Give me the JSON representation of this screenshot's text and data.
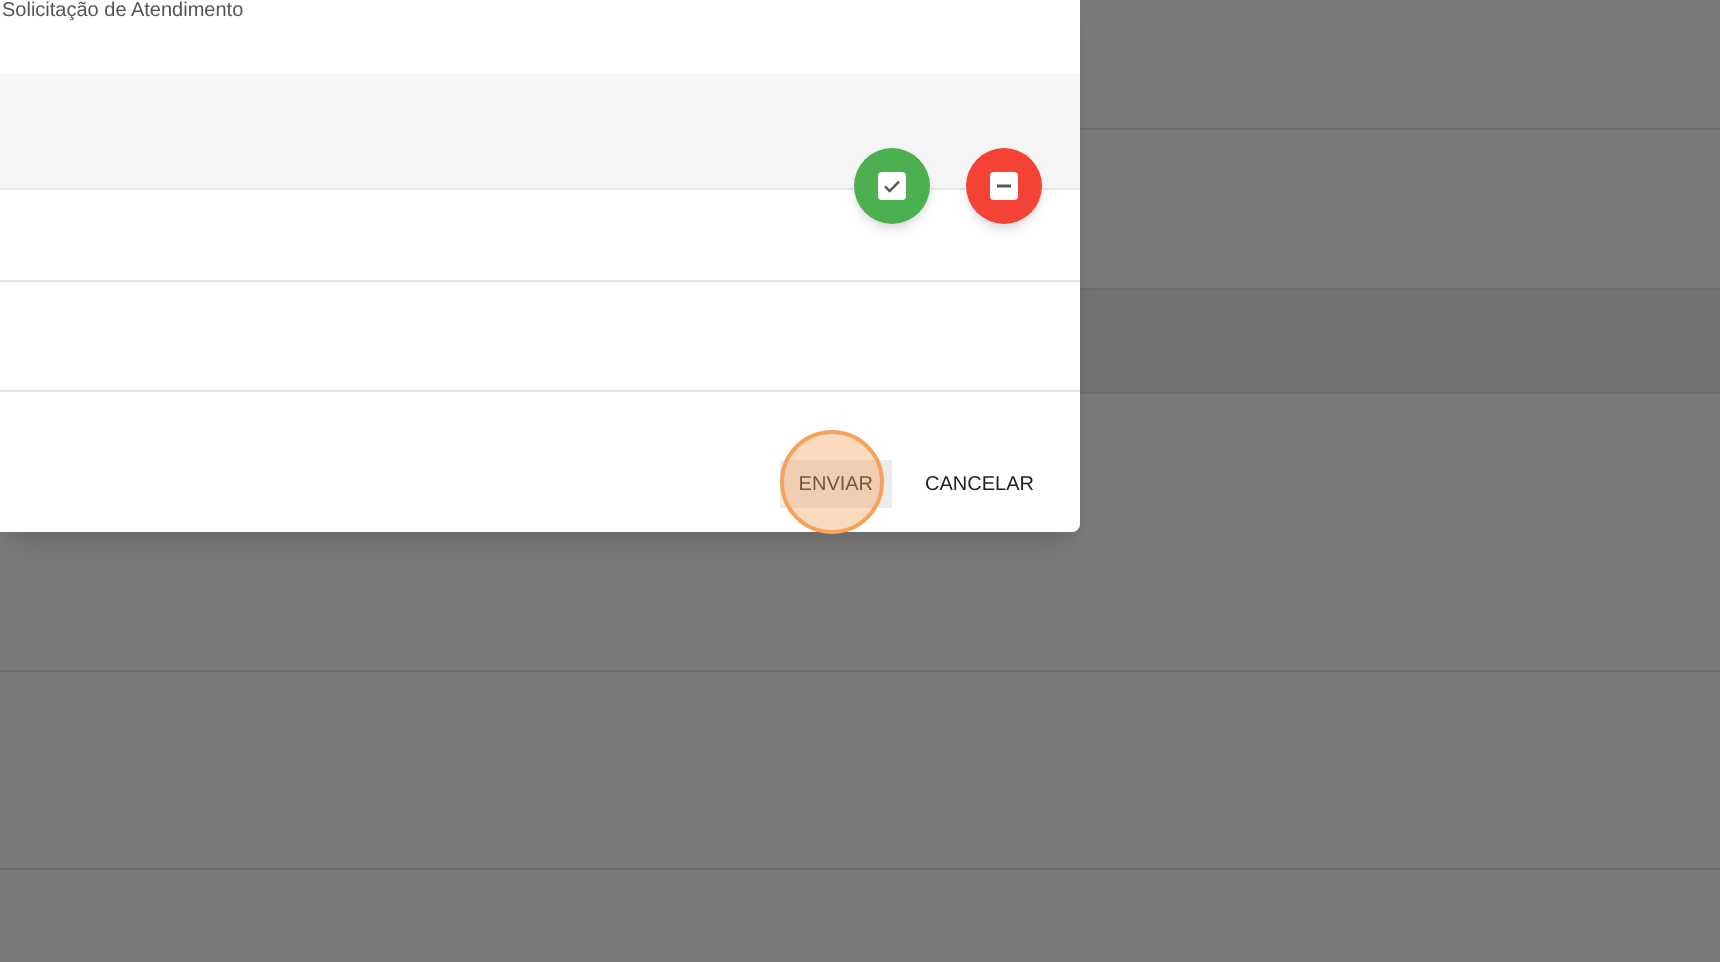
{
  "dialog": {
    "title": "Solicitação de Atendimento",
    "actions": [
      {
        "kind": "approve"
      },
      {
        "kind": "remove"
      }
    ],
    "buttons": [
      {
        "label": "ENVIAR",
        "highlighted": true
      },
      {
        "label": "CANCELAR",
        "highlighted": false
      }
    ]
  }
}
